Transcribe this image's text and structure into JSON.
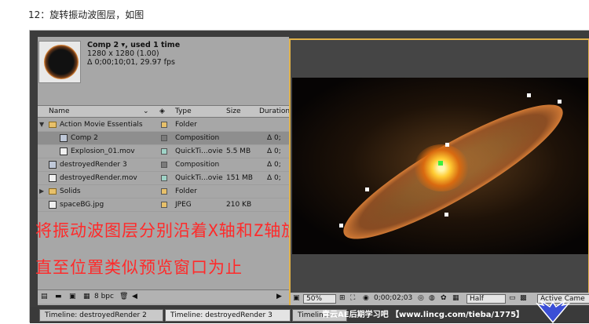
{
  "caption": "12：旋转振动波图层，如图",
  "project": {
    "comp_title": "Comp 2 ▾, used 1 time",
    "dims": "1280 x 1280 (1.00)",
    "duration": "Δ 0;00;10;01, 29.97 fps",
    "columns": [
      "Name",
      "Type",
      "Size",
      "Duration"
    ],
    "items": [
      {
        "name": "Action Movie Essentials",
        "type": "Folder",
        "size": "",
        "dur": "",
        "kind": "folder",
        "indent": 0,
        "swatch": "#e7c06a"
      },
      {
        "name": "Comp 2",
        "type": "Composition",
        "size": "",
        "dur": "Δ 0;",
        "kind": "comp",
        "indent": 1,
        "swatch": "#7a7a7a"
      },
      {
        "name": "Explosion_01.mov",
        "type": "QuickTi...ovie",
        "size": "5.5 MB",
        "dur": "Δ 0;",
        "kind": "file",
        "indent": 1,
        "swatch": "#9fd3c7"
      },
      {
        "name": "destroyedRender 3",
        "type": "Composition",
        "size": "",
        "dur": "Δ 0;",
        "kind": "comp",
        "indent": 0,
        "swatch": "#7a7a7a"
      },
      {
        "name": "destroyedRender.mov",
        "type": "QuickTi...ovie",
        "size": "151 MB",
        "dur": "Δ 0;",
        "kind": "file",
        "indent": 0,
        "swatch": "#9fd3c7"
      },
      {
        "name": "Solids",
        "type": "Folder",
        "size": "",
        "dur": "",
        "kind": "folder",
        "indent": 0,
        "swatch": "#e7c06a"
      },
      {
        "name": "spaceBG.jpg",
        "type": "JPEG",
        "size": "210 KB",
        "dur": "",
        "kind": "file",
        "indent": 0,
        "swatch": "#e7c06a"
      }
    ],
    "bpc": "8 bpc"
  },
  "overlay": {
    "line1": "将振动波图层分别沿着X轴和Z轴旋转",
    "line2": "直至位置类似预览窗口为止"
  },
  "viewer": {
    "zoom": "50%",
    "timecode": "0;00;02;03",
    "resolution": "Half",
    "camera": "Active Came"
  },
  "tabs": [
    "Timeline: destroyedRender 2",
    "Timeline: destroyedRender 3",
    "Timeline: ..."
  ],
  "watermark": "青云AE后期学习吧 【www.lincg.com/tieba/1775】"
}
